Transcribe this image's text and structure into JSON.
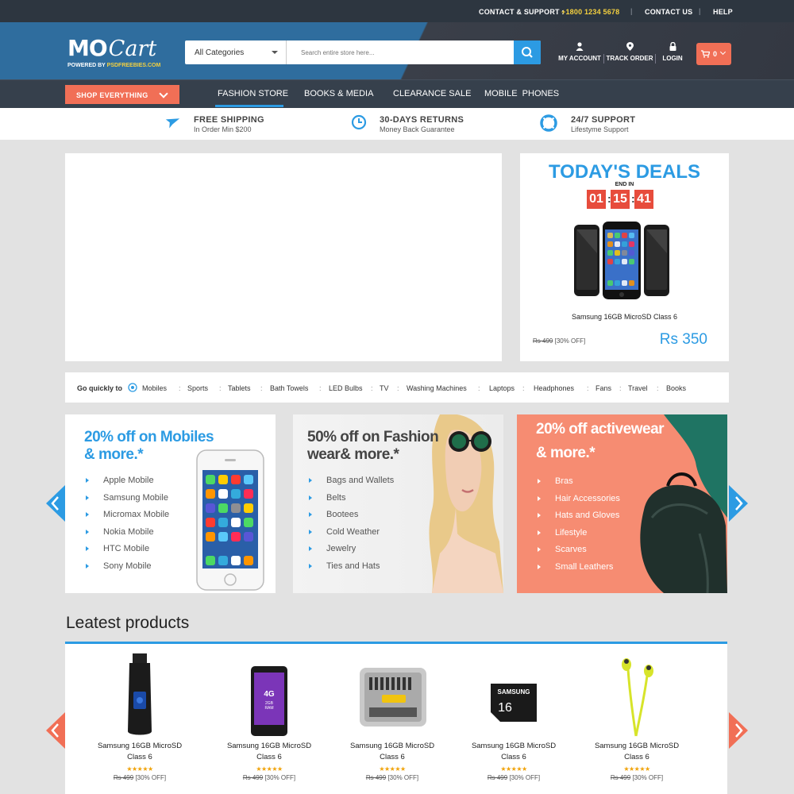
{
  "topbar": {
    "contact_label": "CONTACT & SUPPORT :",
    "phone": "+1800 1234 5678",
    "contact_us": "CONTACT US",
    "help": "HELP"
  },
  "logo": {
    "mo": "MO",
    "cart": "Cart",
    "powered_prefix": "POWERED BY ",
    "powered_brand": "PSDFREEBIES.COM"
  },
  "search": {
    "category": "All Categories",
    "placeholder": "Search entire store here..."
  },
  "header_links": {
    "account": "MY ACCOUNT",
    "track": "TRACK ORDER",
    "login": "LOGIN"
  },
  "cart": {
    "count": "0"
  },
  "nav": {
    "shop_label": "SHOP EVERYTHING",
    "items": [
      "FASHION STORE",
      "BOOKS & MEDIA",
      "CLEARANCE SALE",
      "MOBILE  PHONES"
    ],
    "active": "FASHION STORE"
  },
  "features": [
    {
      "title": "FREE SHIPPING",
      "sub": "In Order Min $200",
      "icon": "airplane-icon"
    },
    {
      "title": "30-DAYS RETURNS",
      "sub": "Money Back  Guarantee",
      "icon": "clock-icon"
    },
    {
      "title": "24/7 SUPPORT",
      "sub": "Lifestyme Support",
      "icon": "lifebuoy-icon"
    }
  ],
  "deals": {
    "title": "TODAY'S DEALS",
    "end_label": "END IN",
    "hours": "01",
    "minutes": "15",
    "seconds": "41",
    "product": "Samsung 16GB MicroSD Class 6",
    "old_price": "Rs 499",
    "discount": "[30% OFF]",
    "price": "Rs 350"
  },
  "quick": {
    "label": "Go quickly to",
    "links": [
      "Mobiles",
      "Sports",
      "Tablets",
      "Bath Towels",
      "LED Bulbs",
      "TV",
      "Washing Machines",
      "Laptops",
      "Headphones",
      "Fans",
      "Travel",
      "Books"
    ]
  },
  "promos": [
    {
      "title1": "20% off on Mobiles",
      "title2": "& more.*",
      "items": [
        "Apple Mobile",
        "Samsung Mobile",
        "Micromax Mobile",
        "Nokia Mobile",
        "HTC Mobile",
        "Sony Mobile"
      ]
    },
    {
      "title1": "50% off on Fashion",
      "title2": "wear& more.*",
      "items": [
        "Bags and Wallets",
        "Belts",
        "Bootees",
        "Cold Weather",
        "Jewelry",
        "Ties and Hats"
      ]
    },
    {
      "title1": "20% off activewear",
      "title2": "& more.*",
      "items": [
        "Bras",
        "Hair Accessories",
        "Hats and Gloves",
        "Lifestyle",
        "Scarves",
        "Small Leathers"
      ]
    }
  ],
  "latest": {
    "title": "Leatest products",
    "products": [
      {
        "name1": "Samsung 16GB MicroSD",
        "name2": "Class 6",
        "stars": "★★★★★",
        "old_price": "Rs 499",
        "discount": "[30% OFF]",
        "img": "trimmer"
      },
      {
        "name1": "Samsung 16GB MicroSD",
        "name2": "Class 6",
        "stars": "★★★★★",
        "old_price": "Rs 499",
        "discount": "[30% OFF]",
        "img": "phone"
      },
      {
        "name1": "Samsung 16GB MicroSD",
        "name2": "Class 6",
        "stars": "★★★★★",
        "old_price": "Rs 499",
        "discount": "[30% OFF]",
        "img": "toolkit"
      },
      {
        "name1": "Samsung 16GB MicroSD",
        "name2": "Class 6",
        "stars": "★★★★★",
        "old_price": "Rs 499",
        "discount": "[30% OFF]",
        "img": "sdcard",
        "card_brand": "SAMSUNG",
        "card_size": "16"
      },
      {
        "name1": "Samsung 16GB MicroSD",
        "name2": "Class 6",
        "stars": "★★★★★",
        "old_price": "Rs 499",
        "discount": "[30% OFF]",
        "img": "earphones"
      }
    ]
  },
  "colors": {
    "accent": "#2c9be3",
    "orange": "#f16f56",
    "dark": "#2d3640",
    "timer": "#e74c3c",
    "star": "#f0a30a"
  }
}
